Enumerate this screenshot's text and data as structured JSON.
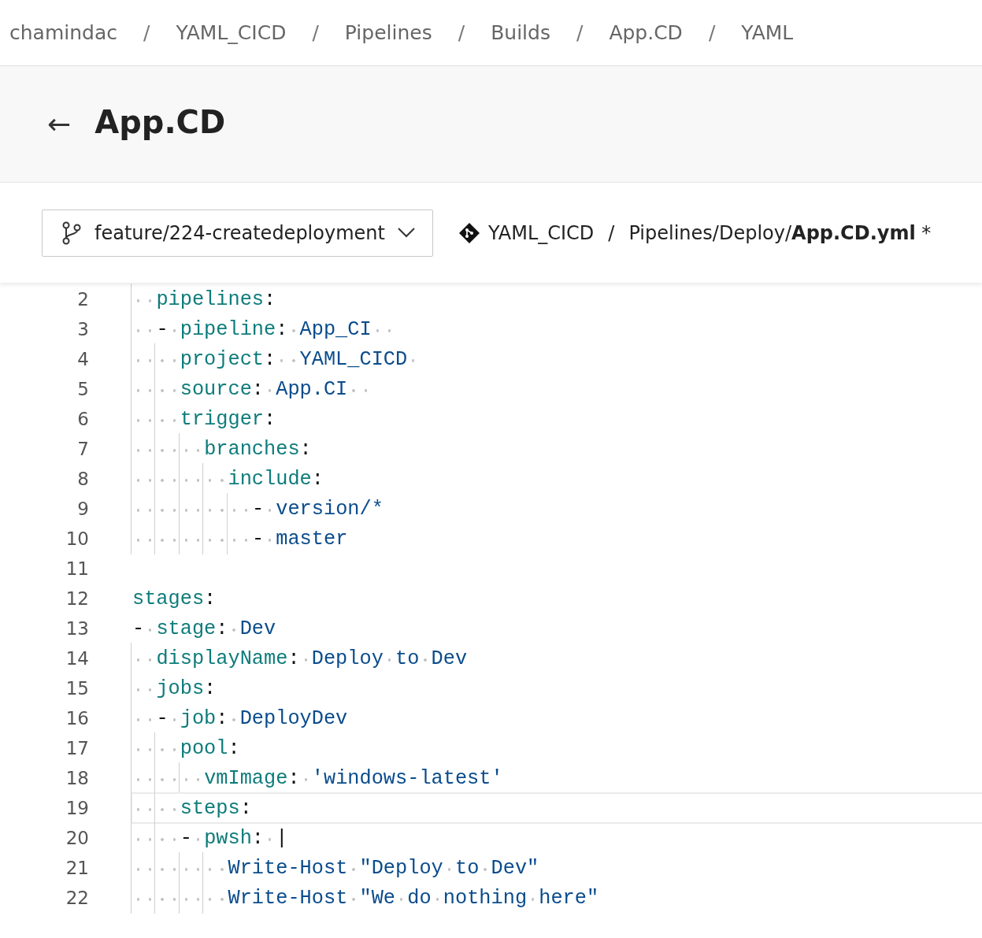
{
  "breadcrumb": {
    "items": [
      "chamindac",
      "YAML_CICD",
      "Pipelines",
      "Builds",
      "App.CD",
      "YAML"
    ],
    "separator": "/"
  },
  "header": {
    "back": "←",
    "title": "App.CD"
  },
  "toolbar": {
    "branch": "feature/224-createdeployment",
    "repo": "YAML_CICD",
    "separator": "/",
    "path": "Pipelines/Deploy/**App.CD.yml** *"
  },
  "editor": {
    "lines": [
      {
        "number": "2",
        "current": false,
        "cursor": false,
        "segments": [
          {
            "kind": "key",
            "text": "  pipelines"
          },
          {
            "kind": "plain",
            "text": ":"
          }
        ]
      },
      {
        "number": "3",
        "current": false,
        "cursor": false,
        "segments": [
          {
            "kind": "plain",
            "text": "  - "
          },
          {
            "kind": "key",
            "text": "pipeline"
          },
          {
            "kind": "plain",
            "text": ": "
          },
          {
            "kind": "value",
            "text": "App_CI  "
          }
        ]
      },
      {
        "number": "4",
        "current": false,
        "cursor": false,
        "segments": [
          {
            "kind": "key",
            "text": "    project"
          },
          {
            "kind": "plain",
            "text": ":  "
          },
          {
            "kind": "value",
            "text": "YAML_CICD "
          }
        ]
      },
      {
        "number": "5",
        "current": false,
        "cursor": false,
        "segments": [
          {
            "kind": "key",
            "text": "    source"
          },
          {
            "kind": "plain",
            "text": ": "
          },
          {
            "kind": "value",
            "text": "App.CI  "
          }
        ]
      },
      {
        "number": "6",
        "current": false,
        "cursor": false,
        "segments": [
          {
            "kind": "key",
            "text": "    trigger"
          },
          {
            "kind": "plain",
            "text": ":"
          }
        ]
      },
      {
        "number": "7",
        "current": false,
        "cursor": false,
        "segments": [
          {
            "kind": "key",
            "text": "      branches"
          },
          {
            "kind": "plain",
            "text": ":"
          }
        ]
      },
      {
        "number": "8",
        "current": false,
        "cursor": false,
        "segments": [
          {
            "kind": "key",
            "text": "        include"
          },
          {
            "kind": "plain",
            "text": ":"
          }
        ]
      },
      {
        "number": "9",
        "current": false,
        "cursor": false,
        "segments": [
          {
            "kind": "plain",
            "text": "          - "
          },
          {
            "kind": "value",
            "text": "version/*"
          }
        ]
      },
      {
        "number": "10",
        "current": false,
        "cursor": false,
        "segments": [
          {
            "kind": "plain",
            "text": "          - "
          },
          {
            "kind": "value",
            "text": "master"
          }
        ]
      },
      {
        "number": "11",
        "current": false,
        "cursor": false
      },
      {
        "number": "12",
        "current": false,
        "cursor": false,
        "segments": [
          {
            "kind": "key",
            "text": "stages"
          },
          {
            "kind": "plain",
            "text": ":"
          }
        ]
      },
      {
        "number": "13",
        "current": false,
        "cursor": false,
        "segments": [
          {
            "kind": "plain",
            "text": "- "
          },
          {
            "kind": "key",
            "text": "stage"
          },
          {
            "kind": "plain",
            "text": ": "
          },
          {
            "kind": "value",
            "text": "Dev"
          }
        ]
      },
      {
        "number": "14",
        "current": false,
        "cursor": false,
        "segments": [
          {
            "kind": "key",
            "text": "  displayName"
          },
          {
            "kind": "plain",
            "text": ": "
          },
          {
            "kind": "value",
            "text": "Deploy to Dev"
          }
        ]
      },
      {
        "number": "15",
        "current": false,
        "cursor": false,
        "segments": [
          {
            "kind": "key",
            "text": "  jobs"
          },
          {
            "kind": "plain",
            "text": ":"
          }
        ]
      },
      {
        "number": "16",
        "current": false,
        "cursor": false,
        "segments": [
          {
            "kind": "plain",
            "text": "  - "
          },
          {
            "kind": "key",
            "text": "job"
          },
          {
            "kind": "plain",
            "text": ": "
          },
          {
            "kind": "value",
            "text": "DeployDev"
          }
        ]
      },
      {
        "number": "17",
        "current": false,
        "cursor": false,
        "segments": [
          {
            "kind": "key",
            "text": "    pool"
          },
          {
            "kind": "plain",
            "text": ":"
          }
        ]
      },
      {
        "number": "18",
        "current": false,
        "cursor": false,
        "segments": [
          {
            "kind": "key",
            "text": "      vmImage"
          },
          {
            "kind": "plain",
            "text": ": "
          },
          {
            "kind": "value",
            "text": "'windows-latest'"
          }
        ]
      },
      {
        "number": "19",
        "current": true,
        "cursor": false,
        "segments": [
          {
            "kind": "key",
            "text": "    steps"
          },
          {
            "kind": "plain",
            "text": ":"
          }
        ]
      },
      {
        "number": "20",
        "current": false,
        "cursor": false,
        "segments": [
          {
            "kind": "plain",
            "text": "    - "
          },
          {
            "kind": "key",
            "text": "pwsh"
          },
          {
            "kind": "plain",
            "text": ": |"
          }
        ]
      },
      {
        "number": "21",
        "current": false,
        "cursor": false,
        "segments": [
          {
            "kind": "value",
            "text": "        Write-Host \"Deploy to Dev\""
          }
        ]
      },
      {
        "number": "22",
        "current": false,
        "cursor": false,
        "segments": [
          {
            "kind": "value",
            "text": "        Write-Host \"We do nothing here\""
          }
        ]
      }
    ]
  }
}
